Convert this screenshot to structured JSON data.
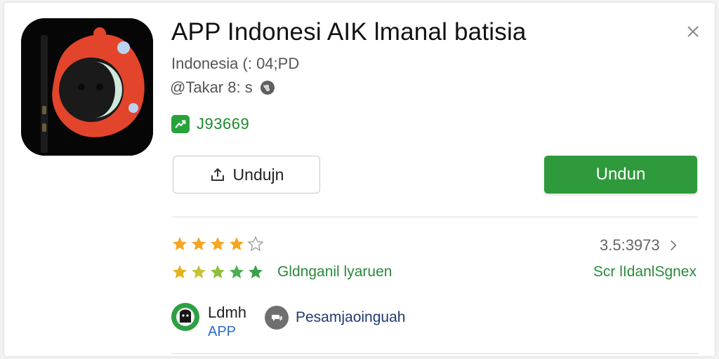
{
  "app": {
    "title": "APP Indonesi AIK lmanal batisia",
    "subtitle": "Indonesia (: 04;PD",
    "meta": "@Takar 8: s",
    "badge_text": "J93669"
  },
  "buttons": {
    "secondary_label": "Undujn",
    "primary_label": "Undun"
  },
  "ratings": {
    "stars_filled": 4,
    "stars_total": 5,
    "count": "3.5:3973",
    "caption": "Gldnganil lyaruen",
    "link": "Scr lIdanlSgnex"
  },
  "developer": {
    "name": "Ldmh",
    "sub": "APP",
    "message_label": "Pesamjaoinguah"
  },
  "colors": {
    "accent_green": "#2e9a3c",
    "star_orange": "#f5a623",
    "icon_red": "#e2452b"
  },
  "icons": {
    "close": "close-icon",
    "globe": "globe-icon",
    "badge": "trend-icon",
    "upload": "upload-icon",
    "chevron": "chevron-right-icon",
    "message": "message-icon"
  }
}
